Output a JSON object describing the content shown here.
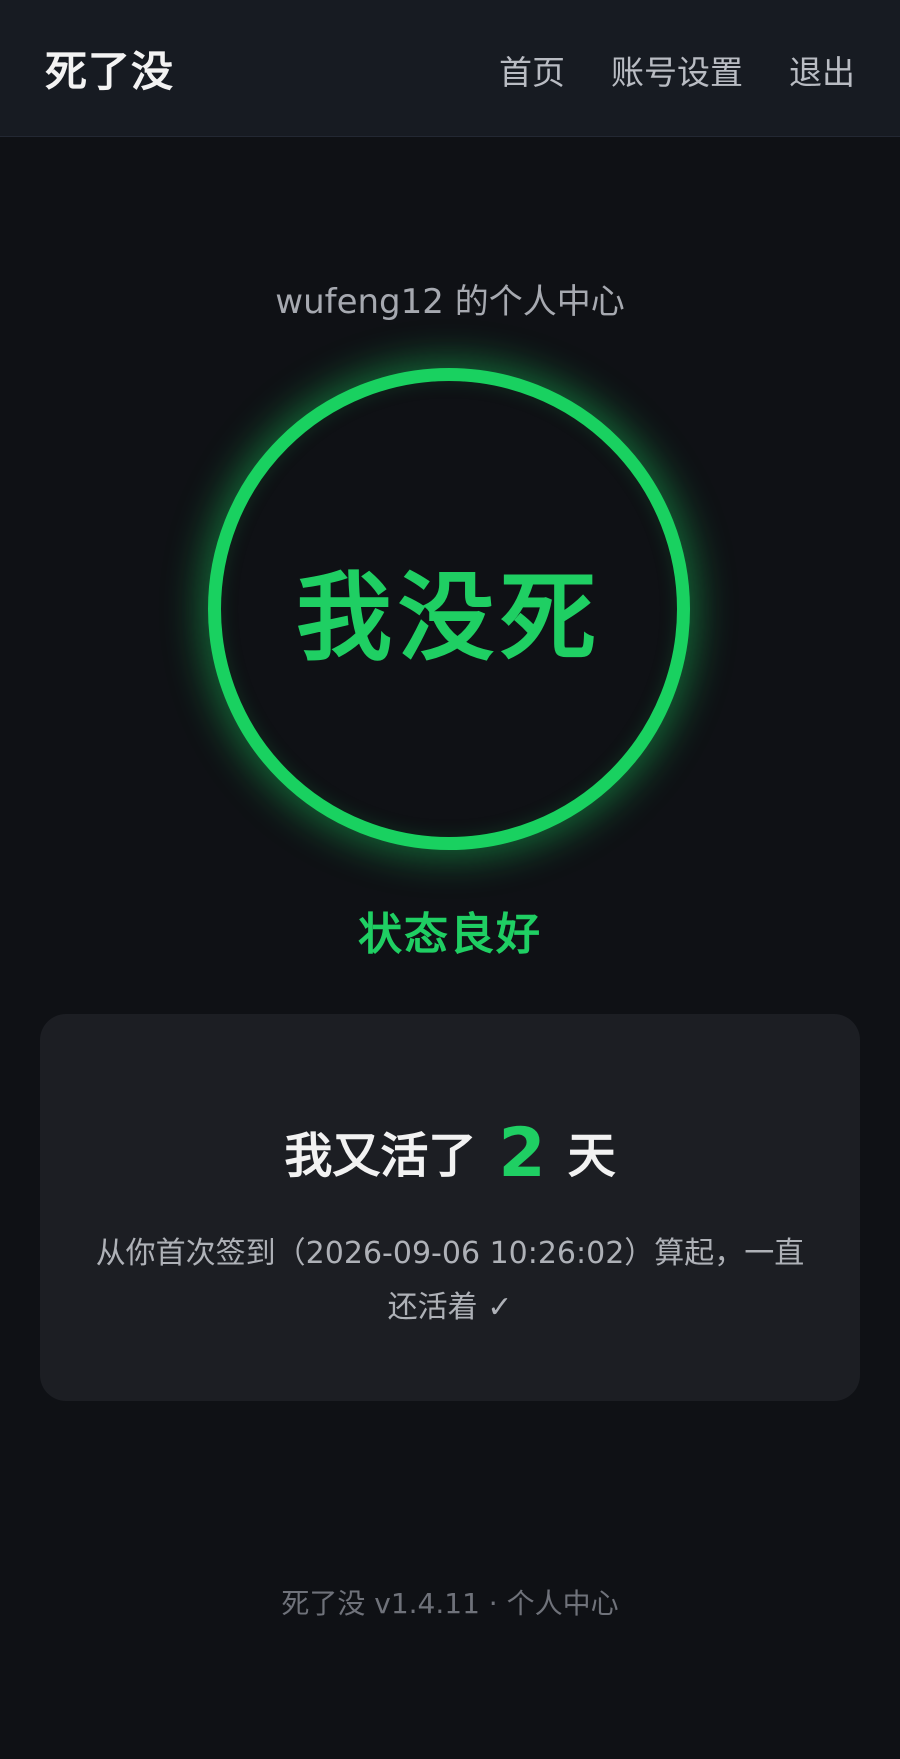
{
  "header": {
    "brand": "死了没",
    "nav": {
      "home": "首页",
      "account_settings": "账号设置",
      "logout": "退出"
    }
  },
  "main": {
    "subtitle": "wufeng12 的个人中心",
    "status_button": "我没死",
    "status_text": "状态良好"
  },
  "card": {
    "prefix": "我又活了",
    "days": "2",
    "suffix": "天",
    "description": "从你首次签到（2026-09-06 10:26:02）算起，一直还活着 ✓"
  },
  "footer": {
    "text": "死了没 v1.4.11 · 个人中心"
  },
  "colors": {
    "background": "#0f1115",
    "accent_green": "#1fcf63",
    "card_bg": "#1c1e23"
  }
}
